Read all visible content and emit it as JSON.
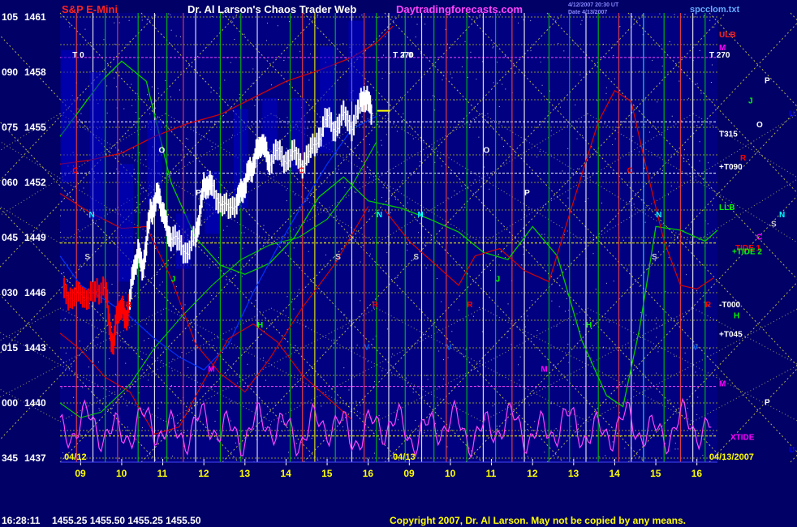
{
  "header": {
    "symbol": "S&P E-Mini",
    "title": "Dr. Al Larson's Chaos Trader Web",
    "site": "Daytradingforecasts.com",
    "timestamp_1": "4/12/2007 20:30 UT",
    "timestamp_2": "Date 4/13/2007",
    "file": "spcclom.txt"
  },
  "footer": {
    "quote_time": "16:28:11",
    "quote_values": "1455.25  1455.50  1455.25  1455.50",
    "copyright": "Copyright 2007, Dr. Al Larson. May not be copied by any means."
  },
  "colors": {
    "background": "#000066",
    "plot_background": "#000080",
    "price_bars_today": "#ffffff",
    "price_bars_prior": "#ff0000",
    "projection_bars": "#0000cc",
    "grid_yellow": "#ffff00",
    "grid_vertical_green": "#00cc00",
    "grid_vertical_red": "#cc0000",
    "oscillator": "#ff44ff",
    "green_curve": "#00cc00",
    "red_curve": "#dd0000",
    "label_magenta": "#ff00ff",
    "label_red": "#ff0000",
    "label_green": "#00ff00",
    "label_cyan": "#00ffff",
    "label_white": "#ffffff"
  },
  "chart_data": {
    "type": "line",
    "ylim": [
      1437,
      1461
    ],
    "y_ticks": [
      {
        "left": "105",
        "price": 1461
      },
      {
        "left": "090",
        "price": 1458
      },
      {
        "left": "075",
        "price": 1455
      },
      {
        "left": "060",
        "price": 1452
      },
      {
        "left": "045",
        "price": 1449
      },
      {
        "left": "030",
        "price": 1446
      },
      {
        "left": "015",
        "price": 1443
      },
      {
        "left": "000",
        "price": 1440
      },
      {
        "left": "345",
        "price": 1437
      }
    ],
    "x_ticks": [
      "09",
      "10",
      "11",
      "12",
      "13",
      "14",
      "15",
      "16",
      "09",
      "10",
      "11",
      "12",
      "13",
      "14",
      "15",
      "16"
    ],
    "x_range_hours": [
      8.5,
      24.5
    ],
    "date_labels": [
      {
        "text": "04/12",
        "hour": 8.6
      },
      {
        "text": "04/13",
        "hour": 16.6
      },
      {
        "text": "04/13/2007",
        "hour": 24.3
      }
    ],
    "price_series": {
      "name": "S&P E-Mini",
      "points": [
        [
          8.6,
          1446.2
        ],
        [
          8.8,
          1445.6
        ],
        [
          9.0,
          1446.0
        ],
        [
          9.2,
          1445.7
        ],
        [
          9.4,
          1446.1
        ],
        [
          9.6,
          1446.4
        ],
        [
          9.7,
          1444.2
        ],
        [
          9.8,
          1443.1
        ],
        [
          9.9,
          1445.0
        ],
        [
          10.0,
          1445.3
        ],
        [
          10.1,
          1444.3
        ],
        [
          10.2,
          1445.8
        ],
        [
          10.3,
          1447.2
        ],
        [
          10.4,
          1448.4
        ],
        [
          10.5,
          1447.1
        ],
        [
          10.6,
          1448.8
        ],
        [
          10.7,
          1450.3
        ],
        [
          10.8,
          1450.9
        ],
        [
          10.9,
          1451.3
        ],
        [
          11.0,
          1450.5
        ],
        [
          11.1,
          1449.4
        ],
        [
          11.2,
          1449.1
        ],
        [
          11.4,
          1448.6
        ],
        [
          11.6,
          1448.3
        ],
        [
          11.8,
          1448.9
        ],
        [
          11.9,
          1450.4
        ],
        [
          12.0,
          1451.7
        ],
        [
          12.1,
          1452.0
        ],
        [
          12.2,
          1451.6
        ],
        [
          12.4,
          1451.0
        ],
        [
          12.6,
          1450.4
        ],
        [
          12.8,
          1451.1
        ],
        [
          12.9,
          1451.3
        ],
        [
          13.0,
          1452.0
        ],
        [
          13.1,
          1452.5
        ],
        [
          13.2,
          1453.0
        ],
        [
          13.3,
          1453.6
        ],
        [
          13.4,
          1454.3
        ],
        [
          13.5,
          1453.6
        ],
        [
          13.6,
          1453.2
        ],
        [
          13.8,
          1453.6
        ],
        [
          14.0,
          1453.3
        ],
        [
          14.2,
          1453.5
        ],
        [
          14.4,
          1453.1
        ],
        [
          14.6,
          1453.6
        ],
        [
          14.8,
          1454.6
        ],
        [
          15.0,
          1455.4
        ],
        [
          15.2,
          1455.0
        ],
        [
          15.4,
          1455.6
        ],
        [
          15.6,
          1455.1
        ],
        [
          15.8,
          1456.1
        ],
        [
          15.9,
          1456.8
        ],
        [
          16.0,
          1456.3
        ],
        [
          16.1,
          1455.8
        ]
      ]
    },
    "series_labels": [
      {
        "text": "T 0",
        "hour": 8.8,
        "price": 1458.8,
        "color": "#ffffff"
      },
      {
        "text": "T 270",
        "hour": 16.6,
        "price": 1458.8,
        "color": "#ffffff"
      },
      {
        "text": "T 0",
        "hour": 16.8,
        "price": 1458.8,
        "color": "#ffffff"
      },
      {
        "text": "T 270",
        "hour": 24.3,
        "price": 1458.8,
        "color": "#ffffff"
      },
      {
        "text": "O",
        "hour": 10.9,
        "price": 1453.6,
        "color": "#ffffff"
      },
      {
        "text": "O",
        "hour": 18.8,
        "price": 1453.6,
        "color": "#ffffff"
      },
      {
        "text": "P",
        "hour": 11.8,
        "price": 1451.3,
        "color": "#ffffff"
      },
      {
        "text": "P",
        "hour": 19.8,
        "price": 1451.3,
        "color": "#ffffff"
      },
      {
        "text": "C",
        "hour": 8.8,
        "price": 1452.5,
        "color": "#ff0000"
      },
      {
        "text": "C",
        "hour": 14.3,
        "price": 1452.5,
        "color": "#ff0000"
      },
      {
        "text": "C",
        "hour": 22.3,
        "price": 1452.5,
        "color": "#ff0000"
      },
      {
        "text": "N",
        "hour": 9.2,
        "price": 1450.1,
        "color": "#00ffff"
      },
      {
        "text": "N",
        "hour": 16.2,
        "price": 1450.1,
        "color": "#00ffff"
      },
      {
        "text": "N",
        "hour": 17.2,
        "price": 1450.1,
        "color": "#00ffff"
      },
      {
        "text": "N",
        "hour": 23.0,
        "price": 1450.1,
        "color": "#00ffff"
      },
      {
        "text": "S",
        "hour": 9.1,
        "price": 1447.8,
        "color": "#cccccc"
      },
      {
        "text": "S",
        "hour": 15.2,
        "price": 1447.8,
        "color": "#cccccc"
      },
      {
        "text": "S",
        "hour": 17.1,
        "price": 1447.8,
        "color": "#cccccc"
      },
      {
        "text": "S",
        "hour": 22.9,
        "price": 1447.8,
        "color": "#cccccc"
      },
      {
        "text": "J",
        "hour": 11.2,
        "price": 1446.6,
        "color": "#00ff00"
      },
      {
        "text": "J",
        "hour": 19.1,
        "price": 1446.6,
        "color": "#00ff00"
      },
      {
        "text": "R",
        "hour": 10.1,
        "price": 1445.2,
        "color": "#ff0000"
      },
      {
        "text": "R",
        "hour": 16.1,
        "price": 1445.2,
        "color": "#ff0000"
      },
      {
        "text": "R",
        "hour": 18.4,
        "price": 1445.2,
        "color": "#ff0000"
      },
      {
        "text": "R",
        "hour": 24.2,
        "price": 1445.2,
        "color": "#ff0000"
      },
      {
        "text": "H",
        "hour": 13.3,
        "price": 1444.1,
        "color": "#00ff00"
      },
      {
        "text": "H",
        "hour": 21.3,
        "price": 1444.1,
        "color": "#00ff00"
      },
      {
        "text": "V",
        "hour": 15.9,
        "price": 1442.9,
        "color": "#0066ff"
      },
      {
        "text": "V",
        "hour": 17.9,
        "price": 1442.9,
        "color": "#0066ff"
      },
      {
        "text": "V",
        "hour": 23.9,
        "price": 1442.9,
        "color": "#0066ff"
      },
      {
        "text": "M",
        "hour": 12.1,
        "price": 1441.7,
        "color": "#ff00ff"
      },
      {
        "text": "M",
        "hour": 20.2,
        "price": 1441.7,
        "color": "#ff00ff"
      }
    ],
    "right_labels": [
      {
        "text": "ULB",
        "price": 1459.9,
        "color": "#ff2222"
      },
      {
        "text": "M",
        "price": 1459.2,
        "color": "#ff00ff"
      },
      {
        "text": "P",
        "price": 1457.4,
        "color": "#ffffff",
        "offset": 56
      },
      {
        "text": "J",
        "price": 1456.3,
        "color": "#00ff00",
        "offset": 36
      },
      {
        "text": "U",
        "price": 1455.6,
        "color": "#0000ff",
        "offset": 86
      },
      {
        "text": "O",
        "price": 1455.0,
        "color": "#ffffff",
        "offset": 46
      },
      {
        "text": "T315",
        "price": 1454.5,
        "color": "#ffffff"
      },
      {
        "text": "R",
        "price": 1453.2,
        "color": "#ff0000",
        "offset": 26
      },
      {
        "text": "+T090",
        "price": 1452.7,
        "color": "#ffffff"
      },
      {
        "text": "LLB",
        "price": 1450.5,
        "color": "#00ff00"
      },
      {
        "text": "N",
        "price": 1450.1,
        "color": "#00ffff",
        "offset": 74
      },
      {
        "text": "S",
        "price": 1449.6,
        "color": "#cccccc",
        "offset": 64
      },
      {
        "text": "C",
        "price": 1448.9,
        "color": "#ff00ff",
        "offset": 46
      },
      {
        "text": "TIDE 1",
        "price": 1448.3,
        "color": "#ff0000",
        "offset": 20
      },
      {
        "text": "+TIDE 2",
        "price": 1448.1,
        "color": "#00ff00",
        "offset": 16
      },
      {
        "text": "-T000",
        "price": 1445.2,
        "color": "#ffffff"
      },
      {
        "text": "H",
        "price": 1444.6,
        "color": "#00ff00",
        "offset": 18
      },
      {
        "text": "+T045",
        "price": 1443.6,
        "color": "#ffffff"
      },
      {
        "text": "M",
        "price": 1440.9,
        "color": "#ff00ff"
      },
      {
        "text": "P",
        "price": 1439.9,
        "color": "#ffffff",
        "offset": 56
      },
      {
        "text": "XTIDE",
        "price": 1438.0,
        "color": "#ff00ff",
        "offset": 14
      },
      {
        "text": "U",
        "price": 1437.3,
        "color": "#0000ff",
        "offset": 86
      }
    ]
  }
}
